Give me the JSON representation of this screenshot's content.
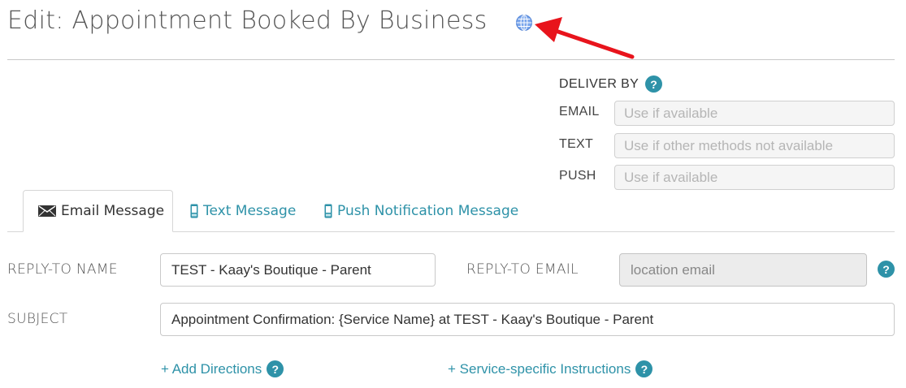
{
  "header": {
    "title": "Edit: Appointment Booked By Business",
    "globe_icon": "globe-icon",
    "annotation_color": "#e8141c"
  },
  "deliver_by": {
    "heading": "DELIVER BY",
    "rows": [
      {
        "label": "EMAIL",
        "value": "Use if available"
      },
      {
        "label": "TEXT",
        "value": "Use if other methods not available"
      },
      {
        "label": "PUSH",
        "value": "Use if available"
      }
    ]
  },
  "tabs": [
    {
      "label": "Email Message",
      "icon": "envelope-icon",
      "active": true
    },
    {
      "label": "Text Message",
      "icon": "mobile-phone-icon",
      "active": false
    },
    {
      "label": "Push Notification Message",
      "icon": "mobile-phone-icon",
      "active": false
    }
  ],
  "form": {
    "reply_to_name_label": "REPLY-TO NAME",
    "reply_to_name_value": "TEST - Kaay's Boutique - Parent",
    "reply_to_email_label": "REPLY-TO EMAIL",
    "reply_to_email_value": "location email",
    "subject_label": "SUBJECT",
    "subject_value": "Appointment Confirmation: {Service Name} at TEST - Kaay's Boutique - Parent"
  },
  "links": {
    "add_directions": "+ Add Directions",
    "service_instructions": "+ Service-specific Instructions"
  },
  "help_glyph": "?",
  "colors": {
    "accent": "#2e92a8",
    "globe": "#6d9be6"
  }
}
